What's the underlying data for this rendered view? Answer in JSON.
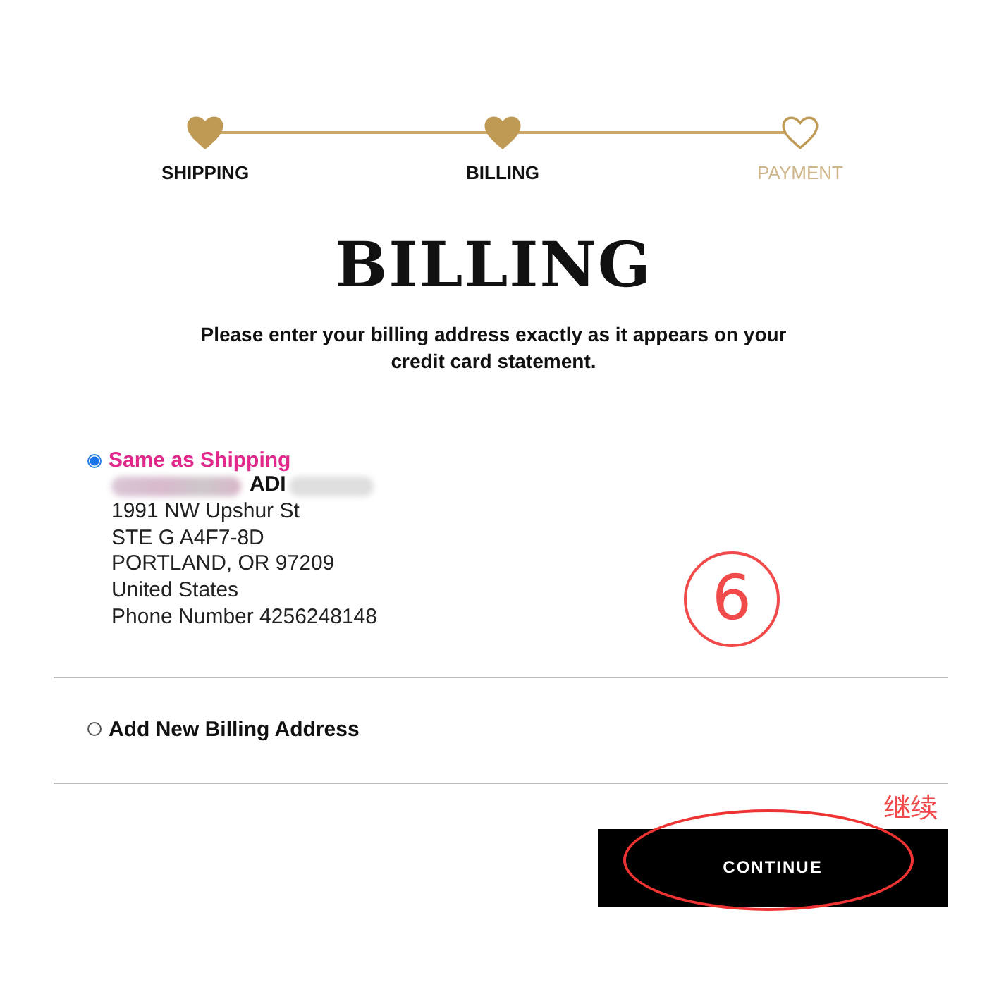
{
  "steps": [
    {
      "label": "SHIPPING",
      "completed": true
    },
    {
      "label": "BILLING",
      "completed": true
    },
    {
      "label": "PAYMENT",
      "completed": false
    }
  ],
  "title": "BILLING",
  "instruction": "Please enter your billing address exactly as it appears on your credit card statement.",
  "options": [
    {
      "kind": "address",
      "label": "Same as Shipping",
      "selected": true,
      "name": "ADI",
      "lines": [
        "1991 NW Upshur St",
        "STE G A4F7-8D",
        "PORTLAND, OR 97209",
        "United States",
        "Phone Number 4256248148"
      ]
    },
    {
      "kind": "new",
      "label": "Add New Billing Address",
      "selected": false
    }
  ],
  "continue_button": "CONTINUE",
  "annotations": {
    "step_number": "6",
    "note": "继续"
  }
}
